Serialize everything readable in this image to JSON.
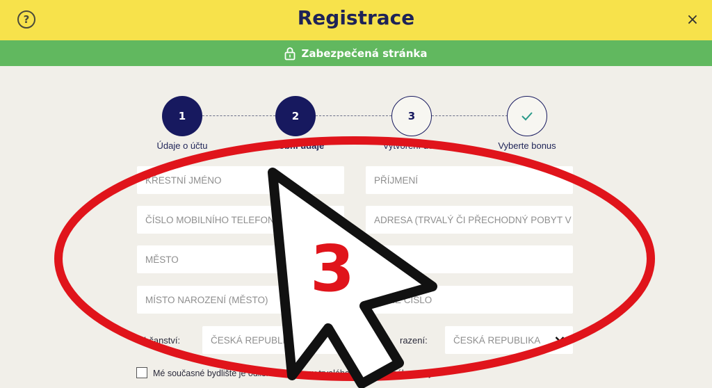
{
  "header": {
    "title": "Registrace",
    "help_icon": "?",
    "close_icon": "×"
  },
  "secure_bar": {
    "text": "Zabezpečená stránka"
  },
  "steps": [
    {
      "number": "1",
      "label": "Údaje o účtu",
      "state": "done"
    },
    {
      "number": "2",
      "label": "Osobní údaje",
      "state": "current"
    },
    {
      "number": "3",
      "label": "Vytvoření účtu",
      "state": "todo"
    },
    {
      "number": "✓",
      "label": "Vyberte bonus",
      "state": "todo"
    }
  ],
  "form": {
    "first_name_placeholder": "KŘESTNÍ JMÉNO",
    "last_name_placeholder": "PŘÍJMENÍ",
    "phone_placeholder": "ČÍSLO MOBILNÍHO TELEFONU: +42",
    "address_placeholder": "ADRESA (TRVALÝ ČI PŘECHODNÝ POBYT V ČR)",
    "city_placeholder": "MĚSTO",
    "postal_code_placeholder": "",
    "birthplace_placeholder": "MÍSTO NAROZENÍ (MĚSTO)",
    "birth_number_placeholder": "ODNÉ ČÍSLO",
    "citizenship_label": "Občanství:",
    "citizenship_value": "ČESKÁ REPUBLIKA",
    "birth_country_label": "razení:",
    "birth_country_value": "ČESKÁ REPUBLIKA",
    "residence_checkbox_label": "Mé současné bydliště je odlišné od adresy trvalého či přechodného pobytu"
  },
  "overlay": {
    "number": "3",
    "ellipse_color": "#e0141b",
    "cursor_fill": "#ffffff",
    "cursor_outline": "#111111",
    "number_color": "#e0141b"
  },
  "colors": {
    "header_bg": "#f7e24b",
    "secure_bar_bg": "#61b85f",
    "navy": "#17195f",
    "page_bg": "#f1efe9"
  }
}
